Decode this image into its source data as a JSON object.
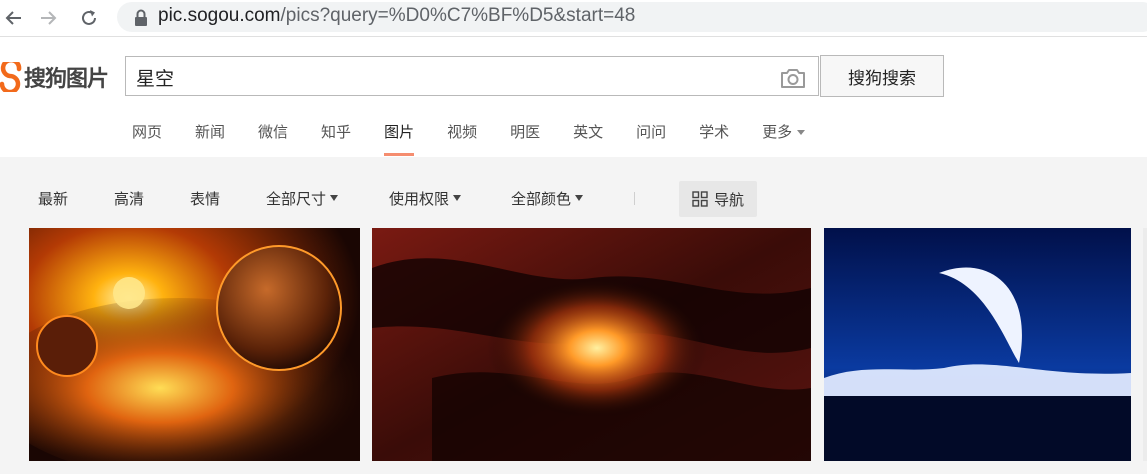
{
  "browser": {
    "back_icon": "arrow-left-icon",
    "forward_icon": "arrow-right-icon",
    "reload_icon": "reload-icon",
    "url_host": "pic.sogou.com",
    "url_rest": "/pics?query=%D0%C7%BF%D5&start=48"
  },
  "header": {
    "logo_text": "搜狗图片",
    "search_value": "星空",
    "search_button": "搜狗搜索",
    "camera_icon": "camera-icon"
  },
  "tabs": [
    {
      "label": "网页"
    },
    {
      "label": "新闻"
    },
    {
      "label": "微信"
    },
    {
      "label": "知乎"
    },
    {
      "label": "图片",
      "active": true
    },
    {
      "label": "视频"
    },
    {
      "label": "明医"
    },
    {
      "label": "英文"
    },
    {
      "label": "问问"
    },
    {
      "label": "学术"
    },
    {
      "label": "更多"
    }
  ],
  "filters": {
    "latest": "最新",
    "hd": "高清",
    "emoji": "表情",
    "size": "全部尺寸",
    "rights": "使用权限",
    "color": "全部颜色",
    "navigation": "导航"
  },
  "colors": {
    "accent": "#f58d6f",
    "logo_orange": "#f26a1b"
  }
}
